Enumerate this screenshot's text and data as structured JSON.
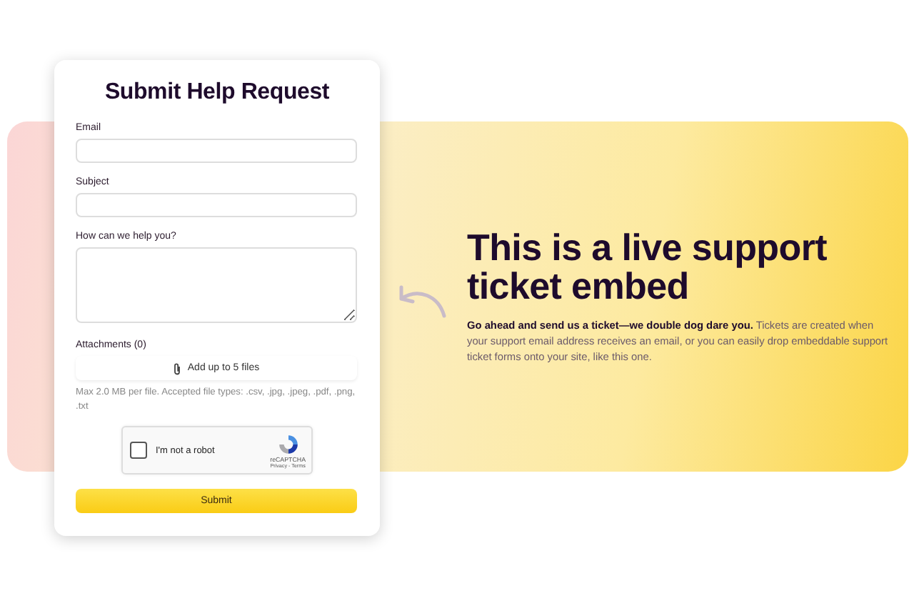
{
  "form": {
    "title": "Submit Help Request",
    "fields": [
      {
        "label": "Email",
        "kind": "input"
      },
      {
        "label": "Subject",
        "kind": "input"
      },
      {
        "label": "How can we help you?",
        "kind": "textarea"
      }
    ],
    "attachments": {
      "label": "Attachments (0)",
      "button": "Add up to 5 files",
      "hint": "Max 2.0 MB per file. Accepted file types: .csv, .jpg, .jpeg, .pdf, .png, .txt"
    },
    "captcha": {
      "label": "I'm not a robot",
      "checked": false,
      "brand": "reCAPTCHA",
      "links": "Privacy - Terms"
    },
    "submit": "Submit"
  },
  "promo": {
    "heading": "This is a live support ticket embed",
    "text": "**Go ahead and send us a ticket—we double dog dare you.** Tickets are created when your support email address receives an email, or you can easily drop embeddable support ticket forms onto your site, like this one."
  }
}
